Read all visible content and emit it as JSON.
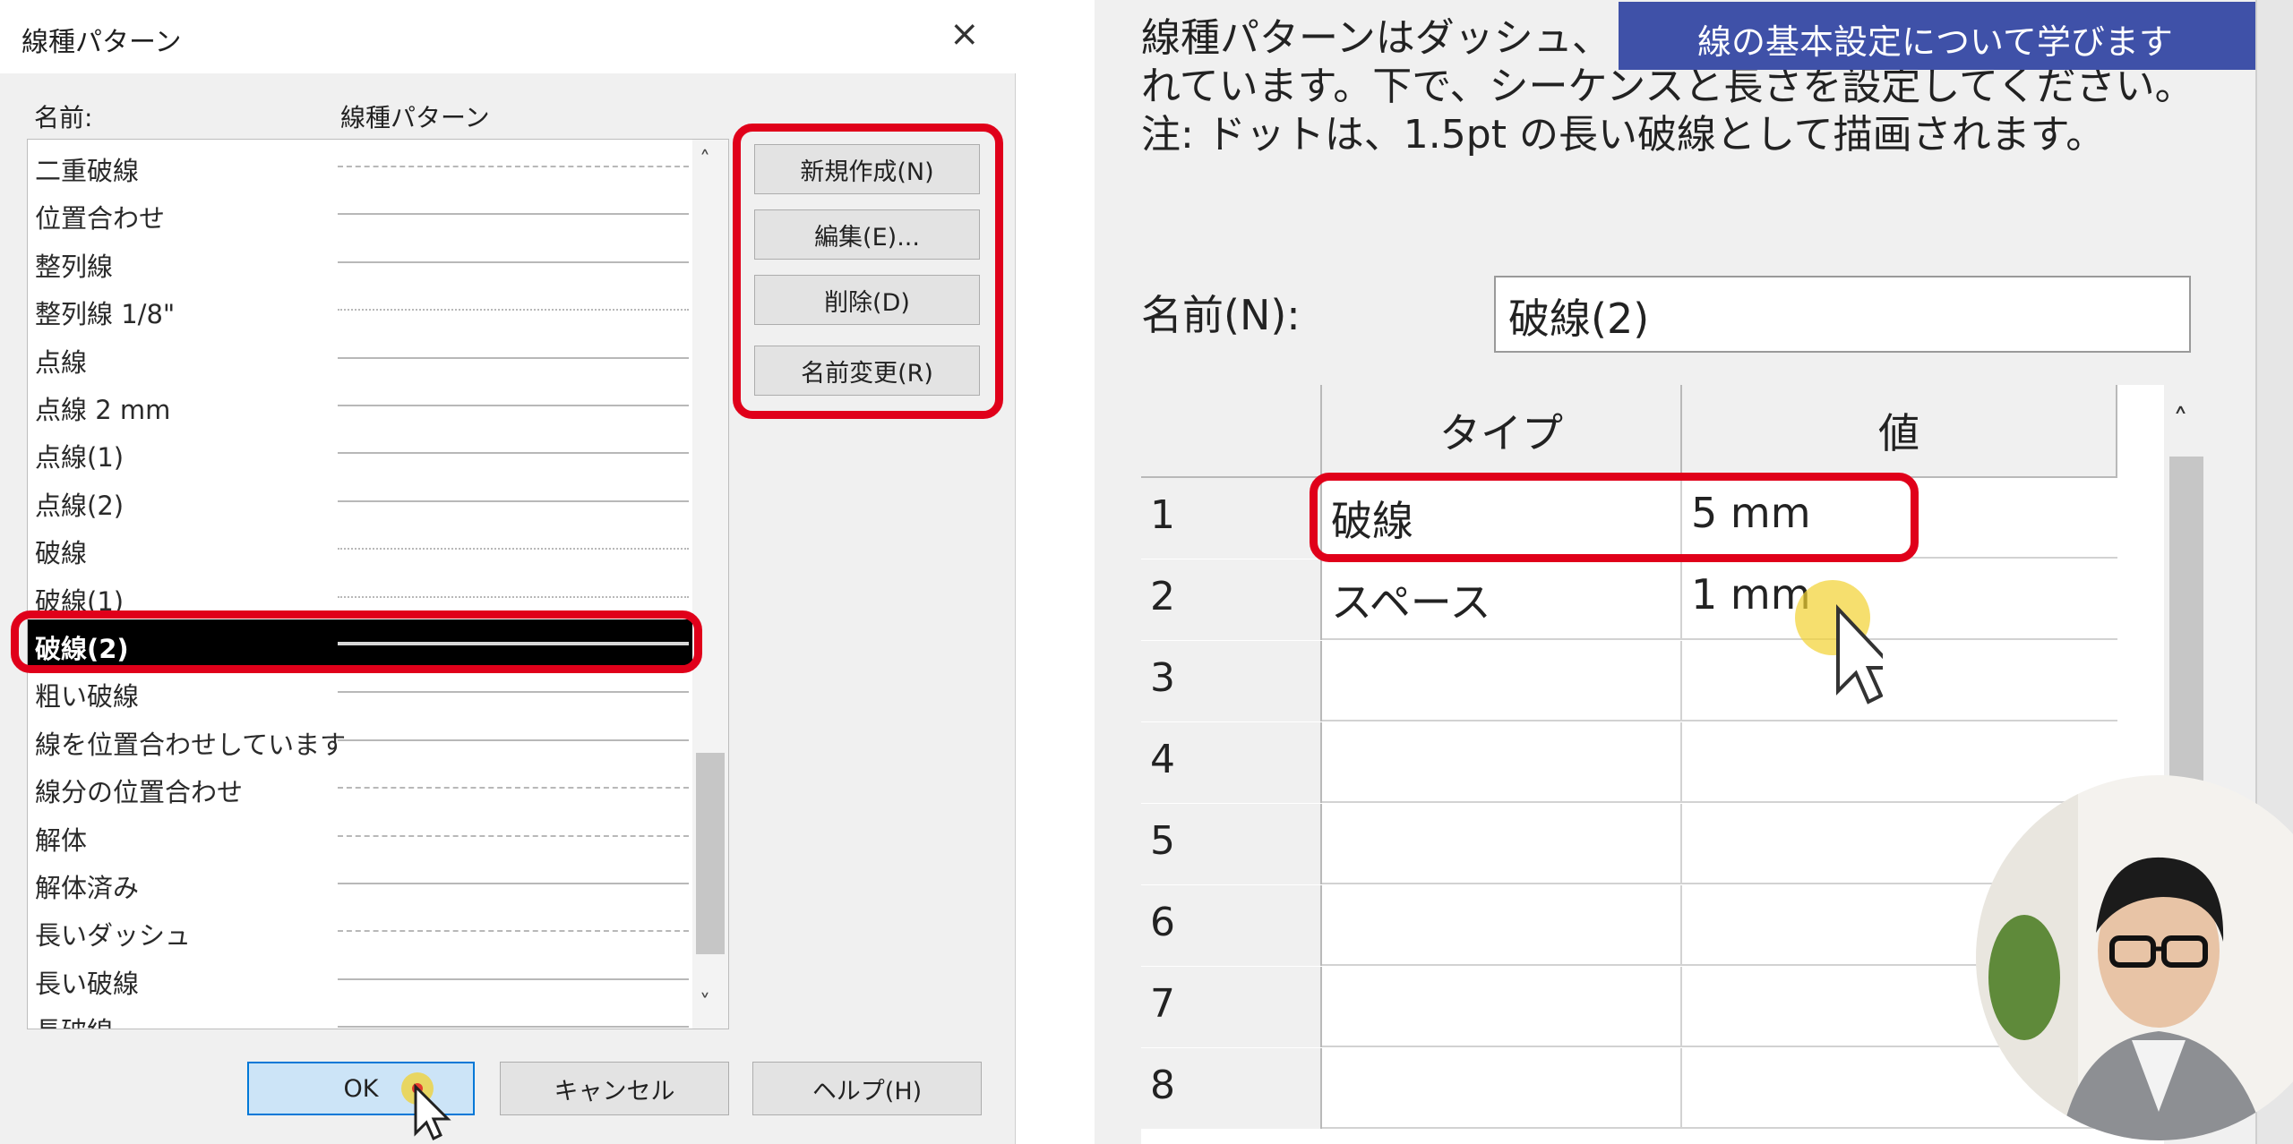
{
  "left_dialog": {
    "title": "線種パターン",
    "close_glyph": "×",
    "col_name": "名前:",
    "col_pattern": "線種パターン",
    "items": [
      {
        "name": "二重破線",
        "style": "dashed"
      },
      {
        "name": "位置合わせ",
        "style": "solid"
      },
      {
        "name": "整列線",
        "style": "solid"
      },
      {
        "name": "整列線 1/8\"",
        "style": "dotted"
      },
      {
        "name": "点線",
        "style": "solid"
      },
      {
        "name": "点線 2 mm",
        "style": "solid"
      },
      {
        "name": "点線(1)",
        "style": "solid"
      },
      {
        "name": "点線(2)",
        "style": "solid"
      },
      {
        "name": "破線",
        "style": "dotted"
      },
      {
        "name": "破線(1)",
        "style": "dotted"
      },
      {
        "name": "破線(2)",
        "style": "solid",
        "selected": true
      },
      {
        "name": "粗い破線",
        "style": "solid"
      },
      {
        "name": "線を位置合わせしています",
        "style": "solid"
      },
      {
        "name": "線分の位置合わせ",
        "style": "dashed"
      },
      {
        "name": "解体",
        "style": "dashed"
      },
      {
        "name": "解体済み",
        "style": "solid"
      },
      {
        "name": "長いダッシュ",
        "style": "dashed"
      },
      {
        "name": "長い破線",
        "style": "solid"
      },
      {
        "name": "長破線",
        "style": "solid"
      }
    ],
    "buttons": {
      "new": "新規作成(N)",
      "edit": "編集(E)...",
      "delete": "削除(D)",
      "rename": "名前変更(R)"
    },
    "footer": {
      "ok": "OK",
      "cancel": "キャンセル",
      "help": "ヘルプ(H)"
    },
    "scroll_up": "˄",
    "scroll_down": "˅"
  },
  "right_dialog": {
    "desc_lines": [
      "線種パターンはダッシュ、ドット、スペースで構成さ",
      "れています。下で、シーケンスと長さを設定してください。",
      "注: ドットは、1.5pt の長い破線として描画されます。"
    ],
    "banner": "線の基本設定について学びます",
    "name_label": "名前(N):",
    "name_value": "破線(2)",
    "grid": {
      "col_type": "タイプ",
      "col_value": "値",
      "scroll_up": "˄",
      "rows": [
        {
          "n": "1",
          "type": "破線",
          "value": "5 mm"
        },
        {
          "n": "2",
          "type": "スペース",
          "value": "1 mm"
        },
        {
          "n": "3",
          "type": "",
          "value": ""
        },
        {
          "n": "4",
          "type": "",
          "value": ""
        },
        {
          "n": "5",
          "type": "",
          "value": ""
        },
        {
          "n": "6",
          "type": "",
          "value": ""
        },
        {
          "n": "7",
          "type": "",
          "value": ""
        },
        {
          "n": "8",
          "type": "",
          "value": ""
        }
      ]
    }
  },
  "colors": {
    "highlight": "#e0001a",
    "banner": "#3f51a8",
    "selection": "#000000",
    "cursor_dot": "#f2d230"
  }
}
